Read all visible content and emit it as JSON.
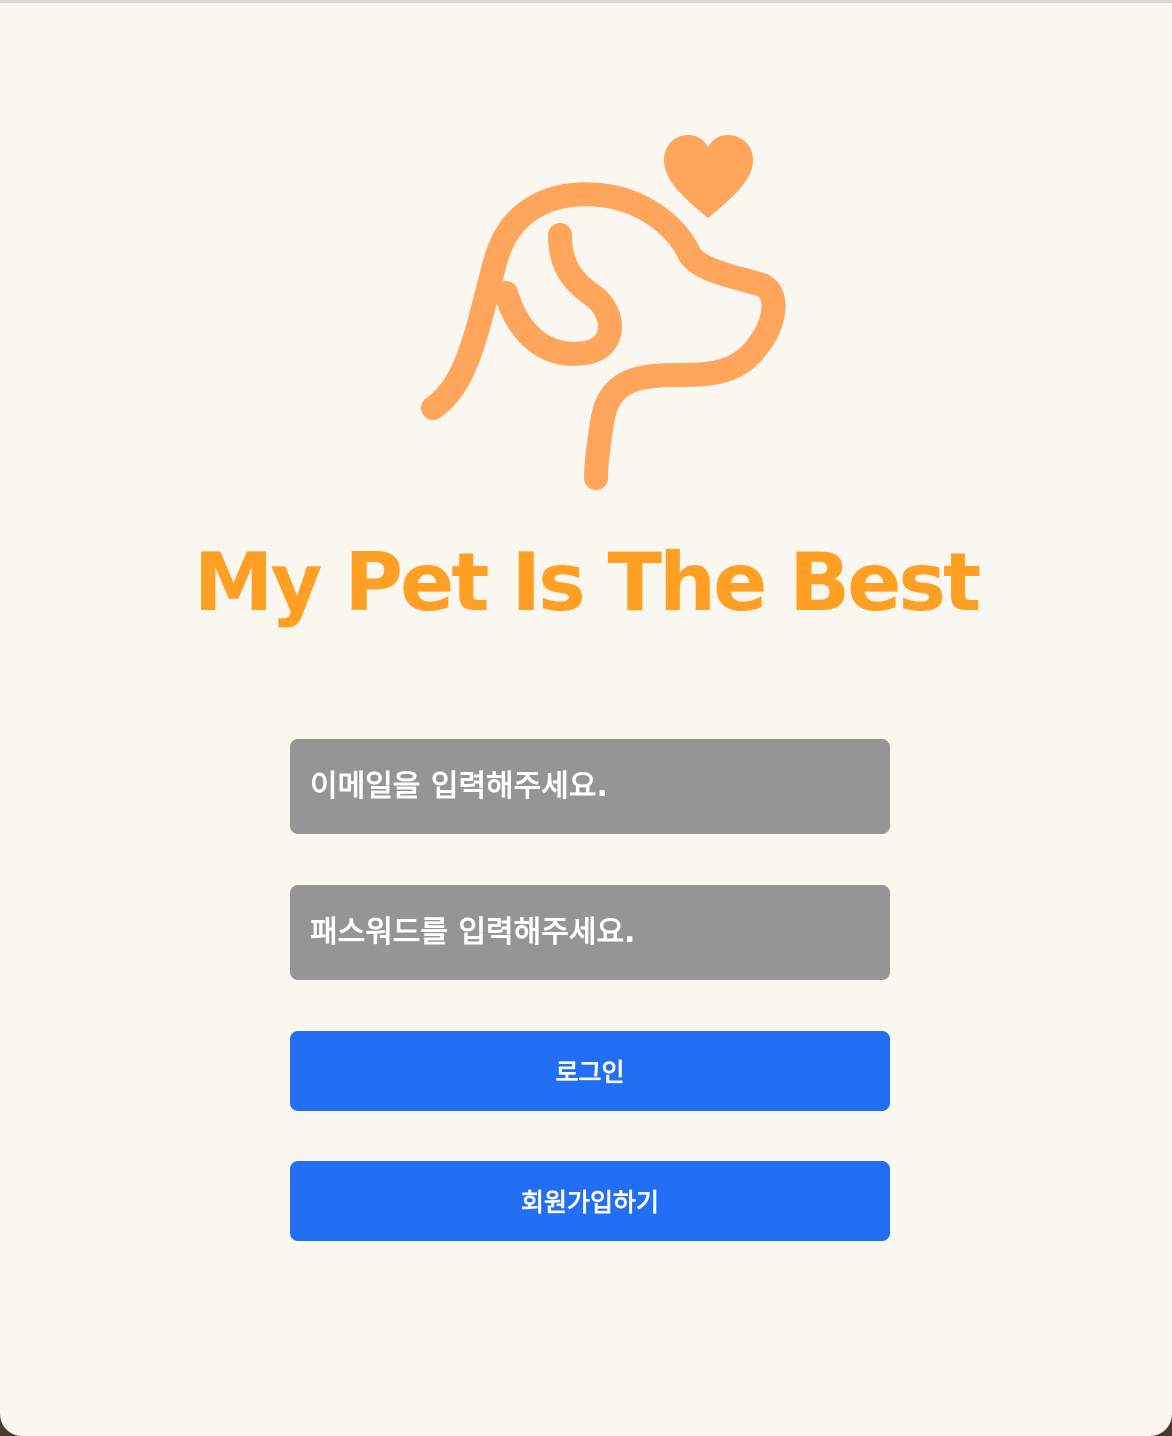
{
  "brand": {
    "title": "My Pet Is The Best",
    "icon": "dog-heart-icon",
    "color": "#ffa025",
    "logo_color": "#ffa55c"
  },
  "login_form": {
    "email_placeholder": "이메일을 입력해주세요.",
    "password_placeholder": "패스워드를 입력해주세요.",
    "login_label": "로그인",
    "signup_label": "회원가입하기"
  },
  "colors": {
    "background": "#faf6f0",
    "field": "#959595",
    "button": "#226ef5"
  }
}
